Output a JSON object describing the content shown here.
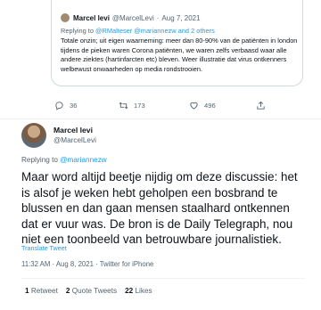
{
  "quoted": {
    "name": "Marcel levi",
    "handle": "@MarcelLevi",
    "dot": "·",
    "date": "Aug 7, 2021",
    "replying_prefix": "Replying to",
    "replying_targets": "@RMalteser @mariannezw and 2 others",
    "text": "Totale onzin; uit eigen waarneming: meer dan 80-90% van de patiënten in london tijdens de pieken waren Corona patiënten, we waren zelfs verbaasd waar alle andere ziektes (hartinfarcten etc) bleven. Weer illustratie dat virus ontkenners welbewust onwaarheden op media rondstrooien."
  },
  "quoted_actions": {
    "reply_count": "36",
    "retweet_count": "173",
    "like_count": "496"
  },
  "tweet": {
    "author_name": "Marcel levi",
    "author_handle": "@MarcelLevi",
    "replying_prefix": "Replying to",
    "replying_target": "@mariannezw",
    "text": "Maar word altijd beetje nijdig om deze discussie: het is alsof je weken hebt geholpen een bosbrand te blussen en dan gaan mensen staalhard ontkennen dat er vuur was. De bron is de Daily Telegraph, nou niet een toonbeeld van betrouwbare journalistiek.",
    "translate_label": "Translate Tweet",
    "timestamp": "11:32 AM · Aug 8, 2021 · Twitter for iPhone"
  },
  "stats": {
    "retweets": "1",
    "retweets_label": "Retweet",
    "quotes": "2",
    "quotes_label": "Quote Tweets",
    "likes": "22",
    "likes_label": "Likes"
  },
  "icons": [
    "reply-icon",
    "retweet-icon",
    "like-icon",
    "share-icon"
  ],
  "colors": {
    "link": "#1d9bf0",
    "muted": "#536471",
    "text": "#0f1419",
    "border": "#cfd9de"
  }
}
